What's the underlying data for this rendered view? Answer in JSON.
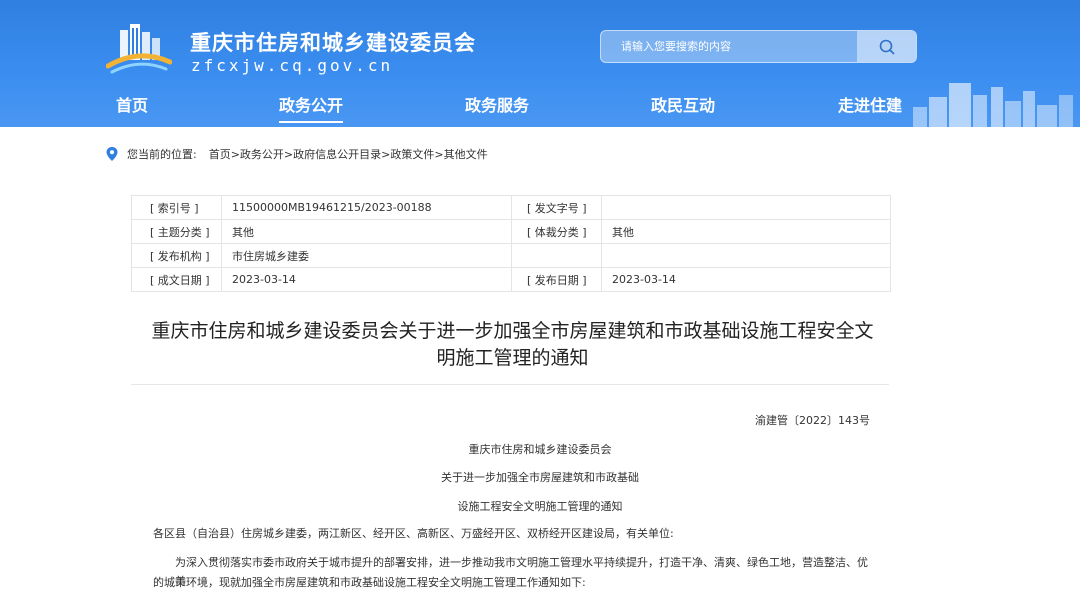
{
  "header": {
    "title": "重庆市住房和城乡建设委员会",
    "domain": "zfcxjw.cq.gov.cn",
    "search_placeholder": "请输入您要搜索的内容",
    "brand_color": "#3b8ef0"
  },
  "nav": {
    "items": [
      {
        "label": "首页",
        "active": false
      },
      {
        "label": "政务公开",
        "active": true
      },
      {
        "label": "政务服务",
        "active": false
      },
      {
        "label": "政民互动",
        "active": false
      },
      {
        "label": "走进住建",
        "active": false
      }
    ]
  },
  "breadcrumb": {
    "label": "您当前的位置:",
    "path": "首页>政务公开>政府信息公开目录>政策文件>其他文件"
  },
  "meta": {
    "rows": [
      {
        "k1": "[ 索引号 ]",
        "v1": "11500000MB19461215/2023-00188",
        "k2": "[ 发文字号 ]",
        "v2": ""
      },
      {
        "k1": "[ 主题分类 ]",
        "v1": "其他",
        "k2": "[ 体裁分类 ]",
        "v2": "其他"
      },
      {
        "k1": "[ 发布机构 ]",
        "v1": "市住房城乡建委",
        "k2": "",
        "v2": ""
      },
      {
        "k1": "[ 成文日期 ]",
        "v1": "2023-03-14",
        "k2": "[ 发布日期 ]",
        "v2": "2023-03-14"
      }
    ]
  },
  "article": {
    "title_line1": "重庆市住房和城乡建设委员会关于进一步加强全市房屋建筑和市政基础设施工程安全文",
    "title_line2": "明施工管理的通知",
    "doc_number": "渝建管〔2022〕143号",
    "center_line1": "重庆市住房和城乡建设委员会",
    "center_line2": "关于进一步加强全市房屋建筑和市政基础",
    "center_line3": "设施工程安全文明施工管理的通知",
    "recipients": "各区县（自治县）住房城乡建委，两江新区、经开区、高新区、万盛经开区、双桥经开区建设局，有关单位:",
    "body_line1": "为深入贯彻落实市委市政府关于城市提升的部署安排，进一步推动我市文明施工管理水平持续提升，打造干净、清爽、绿色工地，营造整洁、优美",
    "body_line2": "的城市环境，现就加强全市房屋建筑和市政基础设施工程安全文明施工管理工作通知如下:"
  }
}
